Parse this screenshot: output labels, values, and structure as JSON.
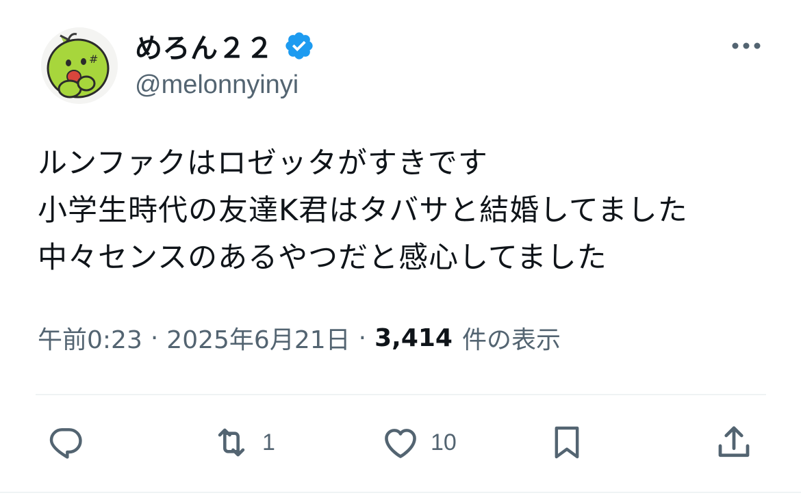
{
  "user": {
    "display_name": "めろん２２",
    "handle": "@melonnyinyi",
    "verified": true,
    "avatar_icon": "melon-character-avatar"
  },
  "tweet": {
    "lines": [
      "ルンファクはロゼッタがすきです",
      "小学生時代の友達K君はタバサと結婚してました",
      "中々センスのあるやつだと感心してました"
    ]
  },
  "meta": {
    "time": "午前0:23",
    "separator": "·",
    "date": "2025年6月21日",
    "views_count": "3,414",
    "views_label": "件の表示"
  },
  "actions": {
    "reply": {
      "icon": "reply-icon",
      "count": ""
    },
    "retweet": {
      "icon": "retweet-icon",
      "count": "1"
    },
    "like": {
      "icon": "heart-icon",
      "count": "10"
    },
    "bookmark": {
      "icon": "bookmark-icon",
      "count": ""
    },
    "share": {
      "icon": "share-icon",
      "count": ""
    }
  },
  "colors": {
    "text_primary": "#0f1419",
    "text_secondary": "#536471",
    "verified_blue": "#1d9bf0",
    "divider": "#eff3f4"
  }
}
